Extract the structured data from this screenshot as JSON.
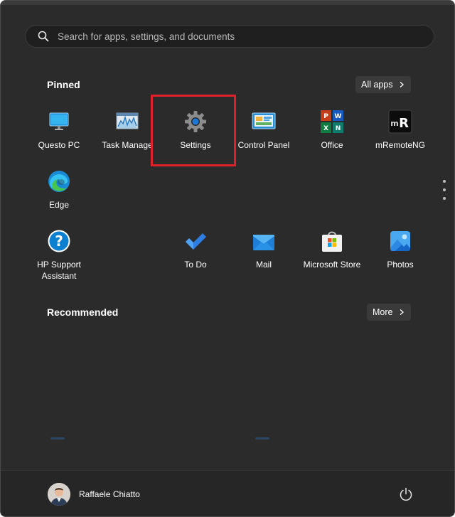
{
  "search": {
    "placeholder": "Search for apps, settings, and documents"
  },
  "pinned": {
    "title": "Pinned",
    "all_apps_label": "All apps",
    "apps": [
      {
        "id": "questo-pc",
        "label": "Questo PC",
        "icon": "monitor-icon"
      },
      {
        "id": "task-manager",
        "label": "Task Manage",
        "icon": "task-manager-icon"
      },
      {
        "id": "settings",
        "label": "Settings",
        "icon": "gear-icon"
      },
      {
        "id": "control-panel",
        "label": "Control Panel",
        "icon": "control-panel-icon"
      },
      {
        "id": "office",
        "label": "Office",
        "icon": "office-icon"
      },
      {
        "id": "mremoteng",
        "label": "mRemoteNG",
        "icon": "mremoteng-icon"
      },
      {
        "id": "edge",
        "label": "Edge",
        "icon": "edge-icon"
      },
      {
        "id": "hp-support",
        "label": "HP Support Assistant",
        "icon": "help-icon"
      },
      {
        "id": "to-do",
        "label": "To Do",
        "icon": "checkmark-icon"
      },
      {
        "id": "mail",
        "label": "Mail",
        "icon": "mail-icon"
      },
      {
        "id": "microsoft-store",
        "label": "Microsoft Store",
        "icon": "store-icon"
      },
      {
        "id": "photos",
        "label": "Photos",
        "icon": "photos-icon"
      }
    ]
  },
  "recommended": {
    "title": "Recommended",
    "more_label": "More"
  },
  "user": {
    "name": "Raffaele Chiatto"
  },
  "colors": {
    "background": "#2b2b2b",
    "highlight": "#e0202a",
    "accent": "#0078d4"
  }
}
